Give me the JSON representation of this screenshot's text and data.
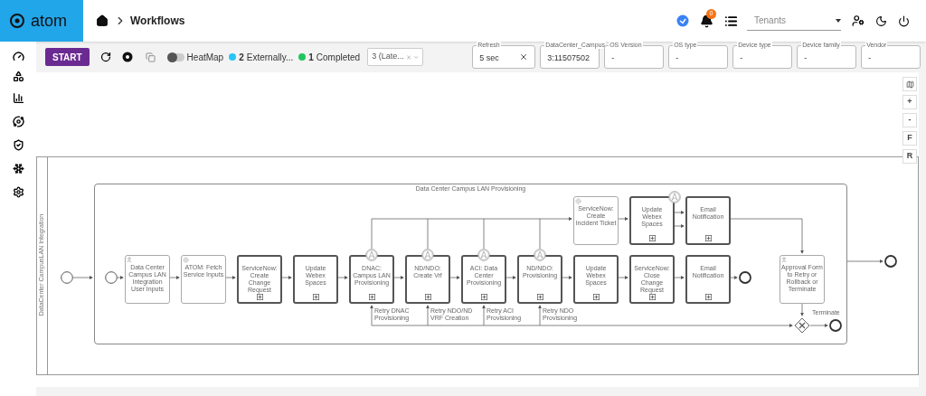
{
  "brand": {
    "name": "atom"
  },
  "breadcrumb": {
    "current": "Workflows"
  },
  "header": {
    "notification_count": "0",
    "tenant_placeholder": "Tenants"
  },
  "toolbar": {
    "start": "START",
    "heatmap": {
      "label": "HeatMap",
      "on": false
    },
    "statuses": [
      {
        "count": "2",
        "label": "Externally...",
        "color": "#29c5f6"
      },
      {
        "count": "1",
        "label": "Completed",
        "color": "#22c55e"
      }
    ],
    "version_select": {
      "value": "3 (Late..."
    }
  },
  "filters": [
    {
      "label": "Refresh",
      "value": "5 sec",
      "clearable": true
    },
    {
      "label": "DataCenter_Campus",
      "value": "3:11507502",
      "clearable": false
    },
    {
      "label": "OS Version",
      "value": "-",
      "clearable": false
    },
    {
      "label": "OS type",
      "value": "-",
      "clearable": false
    },
    {
      "label": "Device type",
      "value": "-",
      "clearable": false
    },
    {
      "label": "Device family",
      "value": "-",
      "clearable": false
    },
    {
      "label": "Vendor",
      "value": "-",
      "clearable": false
    }
  ],
  "zoom_controls": [
    "+",
    "-",
    "F",
    "R"
  ],
  "diagram": {
    "lane": "DataCenter CampusLAN Integration",
    "subprocess": "Data Center Campus LAN Provisioning",
    "tasks": [
      {
        "label": "ServiceNow: Create Incident Ticket",
        "kind": "service",
        "boundary": false
      },
      {
        "label": "Update Webex Spaces",
        "kind": "call",
        "boundary": true
      },
      {
        "label": "Email Notification",
        "kind": "call",
        "boundary": false
      },
      {
        "label": "Data Center Campus LAN Integration User Inputs",
        "kind": "user",
        "boundary": false
      },
      {
        "label": "ATOM: Fetch Service Inputs",
        "kind": "service",
        "boundary": false
      },
      {
        "label": "ServiceNow: Create Change Request",
        "kind": "call",
        "boundary": false
      },
      {
        "label": "Update Webex Spaces",
        "kind": "call",
        "boundary": false
      },
      {
        "label": "DNAC: Campus LAN Provisioning",
        "kind": "call",
        "boundary": true
      },
      {
        "label": "ND/NDO: Create Vrf",
        "kind": "call",
        "boundary": true
      },
      {
        "label": "ACI: Data Center Provisioning",
        "kind": "call",
        "boundary": true
      },
      {
        "label": "ND/NDO: Provisioning",
        "kind": "call",
        "boundary": true
      },
      {
        "label": "Update Webex Spaces",
        "kind": "call",
        "boundary": false
      },
      {
        "label": "ServiceNow: Close Change Request",
        "kind": "call",
        "boundary": false
      },
      {
        "label": "Email Notification",
        "kind": "call",
        "boundary": false
      },
      {
        "label": "Approval Form to Retry or Rollback or Terminate",
        "kind": "user",
        "boundary": false
      }
    ],
    "flow_labels": [
      "Retry DNAC Provisioning",
      "Retry NDO/ND VRF Creation",
      "Retry ACI Provisioning",
      "Retry NDO Provisioning",
      "Terminate"
    ]
  }
}
